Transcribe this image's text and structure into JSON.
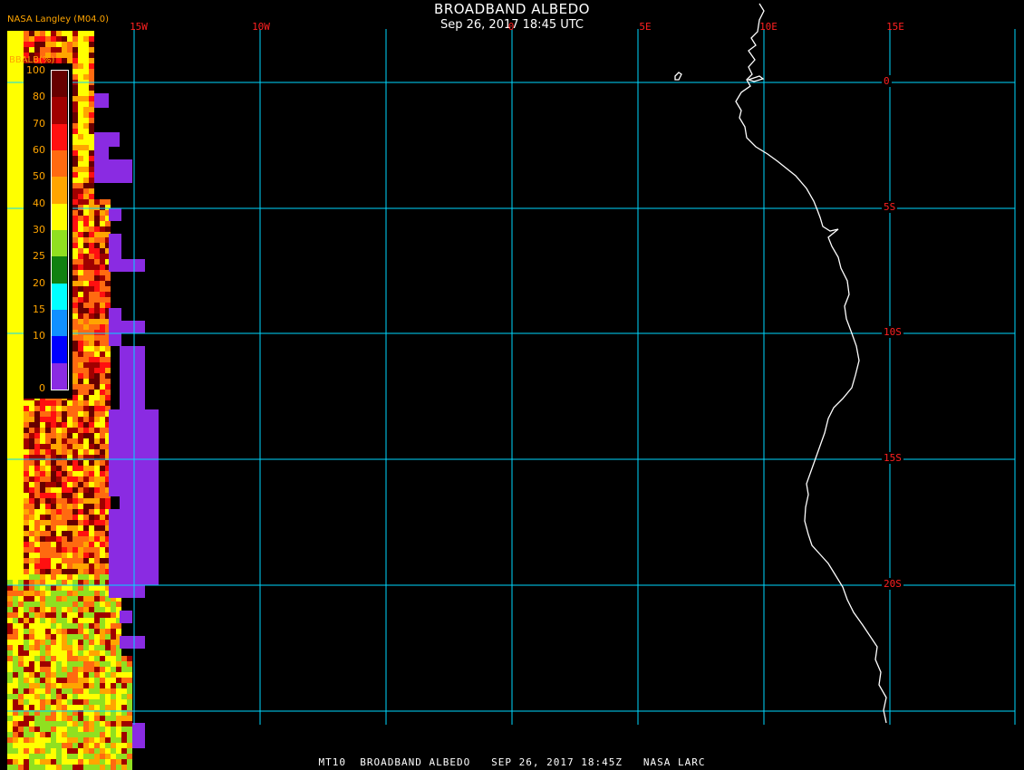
{
  "header": {
    "title": "BROADBAND ALBEDO",
    "datetime": "Sep 26, 2017 18:45 UTC",
    "credit": "NASA Langley (M04.0)"
  },
  "footer": {
    "product": "MT10",
    "name": "BROADBAND ALBEDO",
    "date": "SEP 26, 2017 18:45Z",
    "source": "NASA LARC"
  },
  "longitude_labels": [
    "15W",
    "10W",
    "0",
    "5E",
    "10E",
    "15E"
  ],
  "latitude_labels": [
    "0",
    "5S",
    "10S",
    "15S",
    "20S"
  ],
  "legend": {
    "title": "BBALB(%)",
    "ticks": [
      "100",
      "80",
      "70",
      "60",
      "50",
      "40",
      "30",
      "25",
      "20",
      "15",
      "10",
      "0"
    ],
    "colors": [
      "#660000",
      "#a00000",
      "#ff1010",
      "#ff6a10",
      "#ffa500",
      "#ffff00",
      "#90e020",
      "#108010",
      "#00ffff",
      "#1090ff",
      "#0000ff",
      "#8a2be2"
    ]
  },
  "colors": {
    "grid": "#00d8ff",
    "label": "#ff2020",
    "coast": "#ffffff",
    "legend_text": "#ffa500",
    "missing": "#8a2be2"
  }
}
